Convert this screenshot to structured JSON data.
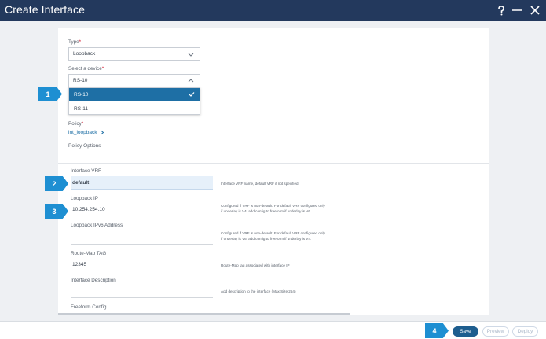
{
  "window": {
    "title": "Create Interface",
    "help_icon": "question-mark-icon",
    "minimize_icon": "minimize-icon",
    "close_icon": "close-icon"
  },
  "form": {
    "type": {
      "label": "Type",
      "value": "Loopback"
    },
    "device": {
      "label": "Select a device",
      "value": "RS-10",
      "options": [
        "RS-10",
        "RS-11"
      ],
      "selected": "RS-10"
    },
    "policy": {
      "label": "Policy",
      "value": "int_loopback"
    },
    "policy_options_label": "Policy Options",
    "fields": {
      "interface_vrf": {
        "label": "Interface VRF",
        "value": "default",
        "help": "Interface VRF name, default VRF if not specified"
      },
      "loopback_ip": {
        "label": "Loopback IP",
        "value": "10.254.254.10",
        "help_line1": "Configured if VRF is non-default. For default VRF configured only",
        "help_line2": "if underlay is V4, add config to freeform if underlay is V6."
      },
      "loopback_ipv6": {
        "label": "Loopback IPv6 Address",
        "value": "",
        "help_line1": "Configured if VRF is non-default. For default VRF configured only",
        "help_line2": "if underlay is V6, add config to freeform if underlay is V4."
      },
      "route_map_tag": {
        "label": "Route-Map TAG",
        "value": "12345",
        "help": "Route-Map tag associated with interface IP"
      },
      "interface_description": {
        "label": "Interface Description",
        "value": "",
        "help": "Add description to the interface (Max Size 254)"
      },
      "freeform_config": {
        "label": "Freeform Config"
      }
    },
    "required_mark": "*"
  },
  "callouts": [
    "1",
    "2",
    "3",
    "4"
  ],
  "footer": {
    "save_label": "Save",
    "preview_label": "Preview",
    "deploy_label": "Deploy"
  },
  "colors": {
    "titlebar": "#23395d",
    "accent": "#1e6fa5",
    "callout": "#1e8fd2",
    "save_button": "#1e5e8f"
  }
}
